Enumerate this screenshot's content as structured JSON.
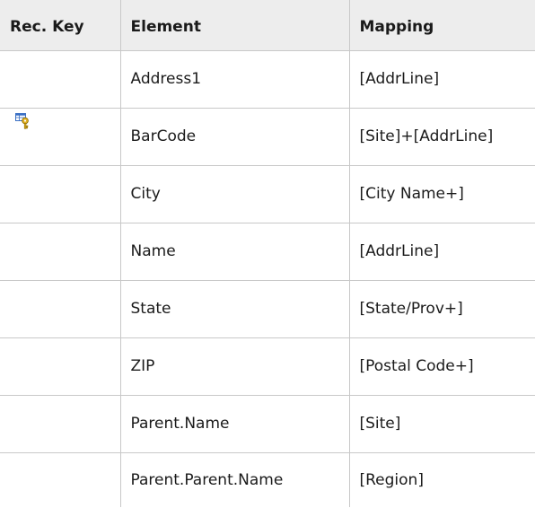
{
  "table": {
    "headers": [
      "Rec. Key",
      "Element",
      "Mapping"
    ],
    "rows": [
      {
        "rec_key": "",
        "key_icon": "",
        "element": "Address1",
        "mapping": "[AddrLine]"
      },
      {
        "rec_key": "",
        "key_icon": "reconciliation-key-icon",
        "element": "BarCode",
        "mapping": "[Site]+[AddrLine]"
      },
      {
        "rec_key": "",
        "key_icon": "",
        "element": "City",
        "mapping": "[City Name+]"
      },
      {
        "rec_key": "",
        "key_icon": "",
        "element": "Name",
        "mapping": "[AddrLine]"
      },
      {
        "rec_key": "",
        "key_icon": "",
        "element": "State",
        "mapping": "[State/Prov+]"
      },
      {
        "rec_key": "",
        "key_icon": "",
        "element": "ZIP",
        "mapping": "[Postal Code+]"
      },
      {
        "rec_key": "",
        "key_icon": "",
        "element": "Parent.Name",
        "mapping": "[Site]"
      },
      {
        "rec_key": "",
        "key_icon": "",
        "element": "Parent.Parent.Name",
        "mapping": "[Region]"
      }
    ]
  },
  "colors": {
    "header_background": "#ededed",
    "border": "#c8c8c8",
    "icon_key_gold": "#e0b020",
    "icon_table_blue": "#3a6fc4"
  }
}
